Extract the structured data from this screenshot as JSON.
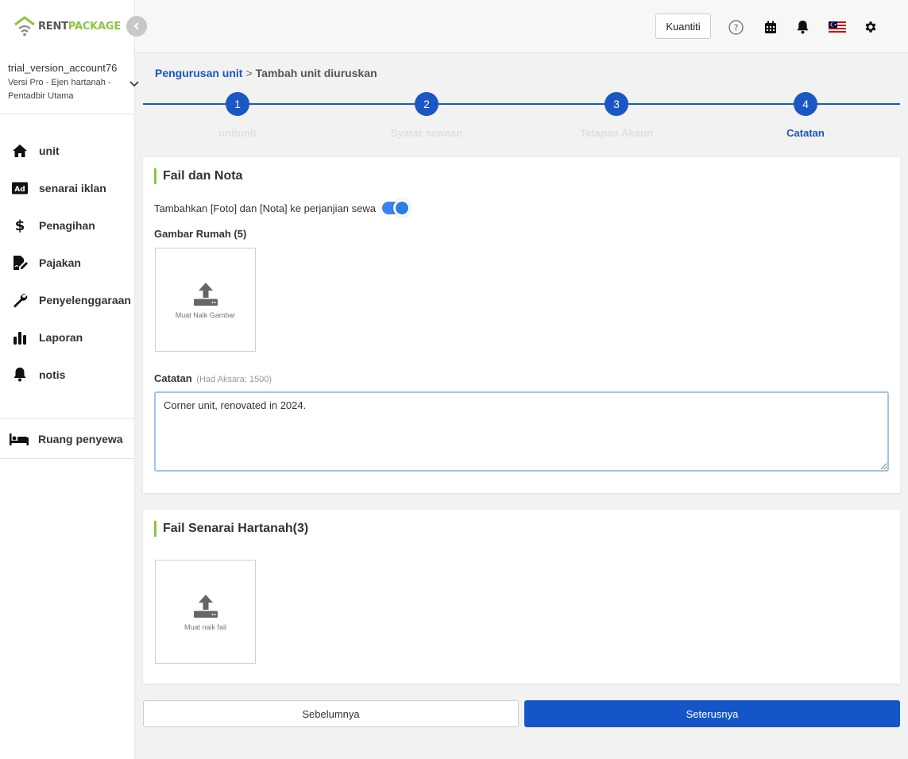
{
  "brand": {
    "name_part1": "RENT",
    "name_part2": "PACKAGE",
    "accent": "#8dc63f",
    "primary": "#1a56c4"
  },
  "account": {
    "name": "trial_version_account76",
    "role": "Versi Pro - Ejen hartanah - Pentadbir Utama"
  },
  "sidebar": {
    "items": [
      {
        "label": "unit",
        "icon": "home-icon"
      },
      {
        "label": "senarai iklan",
        "icon": "ad-icon"
      },
      {
        "label": "Penagihan",
        "icon": "dollar-icon"
      },
      {
        "label": "Pajakan",
        "icon": "contract-icon"
      },
      {
        "label": "Penyelenggaraan",
        "icon": "wrench-icon"
      },
      {
        "label": "Laporan",
        "icon": "bar-chart-icon"
      },
      {
        "label": "notis",
        "icon": "bell-icon"
      }
    ],
    "tenant_room": {
      "label": "Ruang penyewa",
      "icon": "bed-icon"
    }
  },
  "header": {
    "kuantiti_label": "Kuantiti"
  },
  "breadcrumb": {
    "parent": "Pengurusan unit",
    "separator": ">",
    "current": "Tambah unit diuruskan"
  },
  "stepper": {
    "steps": [
      {
        "number": "1",
        "label": "unitunit"
      },
      {
        "number": "2",
        "label": "Syarat sewaan"
      },
      {
        "number": "3",
        "label": "Tetapan Akaun"
      },
      {
        "number": "4",
        "label": "Catatan"
      }
    ],
    "active": 4
  },
  "files_notes": {
    "title": "Fail dan Nota",
    "toggle_label": "Tambahkan [Foto] dan [Nota] ke perjanjian sewa",
    "toggle_on": true,
    "house_images_label": "Gambar Rumah (5)",
    "upload_image_text": "Muat Naik Gambar",
    "notes_label": "Catatan",
    "notes_hint": "(Had Aksara: 1500)",
    "notes_value": "Corner unit, renovated in 2024."
  },
  "property_files": {
    "title": "Fail Senarai Hartanah(3)",
    "upload_file_text": "Muat naik fail"
  },
  "footer": {
    "prev_label": "Sebelumnya",
    "next_label": "Seterusnya"
  }
}
